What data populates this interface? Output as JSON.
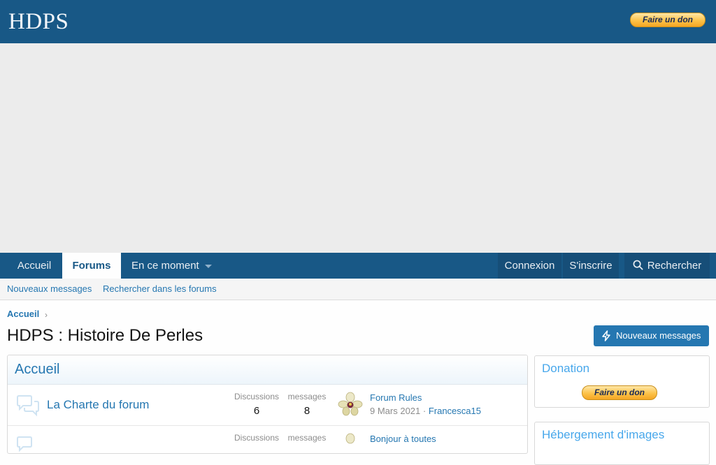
{
  "header": {
    "logo": "HDPS",
    "donate": "Faire un don"
  },
  "nav": {
    "tabs": [
      {
        "label": "Accueil"
      },
      {
        "label": "Forums"
      },
      {
        "label": "En ce moment"
      }
    ],
    "login": "Connexion",
    "register": "S'inscrire",
    "search": "Rechercher"
  },
  "subnav": {
    "new_posts": "Nouveaux messages",
    "search_forums": "Rechercher dans les forums"
  },
  "breadcrumb": {
    "home": "Accueil"
  },
  "page": {
    "title": "HDPS : Histoire De Perles",
    "new_posts_button": "Nouveaux messages"
  },
  "category": {
    "title": "Accueil",
    "nodes": [
      {
        "title": "La Charte du forum",
        "discussions_label": "Discussions",
        "discussions": "6",
        "messages_label": "messages",
        "messages": "8",
        "last_title": "Forum Rules",
        "last_date": "9 Mars 2021",
        "last_user": "Francesca15"
      },
      {
        "title": "",
        "discussions_label": "Discussions",
        "discussions": "",
        "messages_label": "messages",
        "messages": "",
        "last_title": "Bonjour à toutes",
        "last_date": "",
        "last_user": ""
      }
    ]
  },
  "sidebar": {
    "donation_title": "Donation",
    "donate": "Faire un don",
    "images_title": "Hébergement d'images"
  },
  "colors": {
    "brand": "#185886",
    "link": "#2577b1",
    "accent": "#47a7eb"
  }
}
